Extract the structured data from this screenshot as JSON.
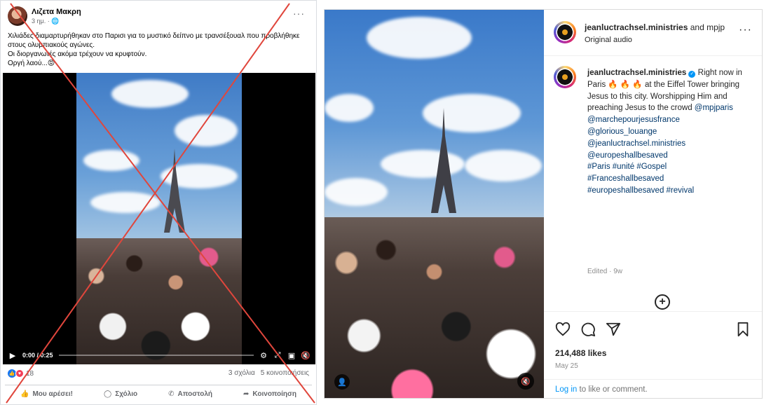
{
  "facebook": {
    "author": "Λιζετα Μακρη",
    "meta": "3 ημ. · ",
    "post_text_lines": [
      "Χιλιάδες διαμαρτυρήθηκαν στο Παρισι για το μυστικό δείπνο με τρανσέξουαλ που προβλήθηκε",
      "στους ολυμπιακούς αγώνες.",
      "Οι διοργανωτές ακόμα τρέχουν να κρυφτούν.",
      "Οργή λαού...😡"
    ],
    "video_time": "0:00 / 0:25",
    "video_progress": 0,
    "reactions_count": "18",
    "comments": "3 σχόλια",
    "shares": "5 κοινοποιήσεις",
    "actions": {
      "like": "Μου αρέσει!",
      "comment": "Σχόλιο",
      "send": "Αποστολή",
      "share": "Κοινοποίηση"
    },
    "overlay_color": "#e0463c"
  },
  "instagram": {
    "header_user": "jeanluctrachsel.ministries",
    "header_and": " and mpjp",
    "header_sub": "Original audio",
    "caption_user": "jeanluctrachsel.ministries",
    "caption_text": "Right now in Paris 🔥 🔥 🔥 at the Eiffel Tower bringing Jesus to this city. Worshipping Him and preaching Jesus to the crowd",
    "mentions": [
      "@mpjparis",
      "@marchepourjesusfrance",
      "@glorious_louange",
      "@jeanluctrachsel.ministries",
      "@europeshallbesaved",
      "#Paris #unité #Gospel",
      "#Franceshallbesaved",
      "#europeshallbesaved #revival"
    ],
    "edited": "Edited · 9w",
    "likes": "214,488 likes",
    "date": "May 25",
    "login_link": "Log in",
    "login_text": " to like or comment."
  }
}
